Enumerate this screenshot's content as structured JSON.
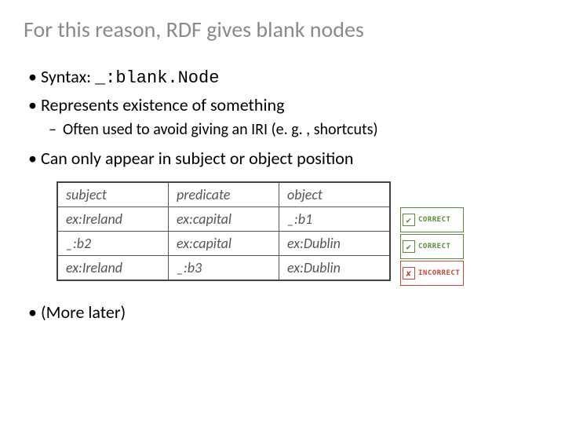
{
  "title": "For this reason, RDF gives blank nodes",
  "bullets": {
    "syntax_label": "Syntax: ",
    "syntax_code": "_:blank.Node",
    "represents": "Represents existence of something",
    "represents_sub": "Often used to avoid giving an IRI (e. g. , shortcuts)",
    "position": "Can only appear in subject or object position",
    "more": "(More later)"
  },
  "table": {
    "headers": {
      "s": "subject",
      "p": "predicate",
      "o": "object"
    },
    "rows": [
      {
        "s": "ex:Ireland",
        "p": "ex:capital",
        "o": "_:b1",
        "status": "correct"
      },
      {
        "s": "_:b2",
        "p": "ex:capital",
        "o": "ex:Dublin",
        "status": "correct"
      },
      {
        "s": "ex:Ireland",
        "p": "_:b3",
        "o": "ex:Dublin",
        "status": "incorrect"
      }
    ]
  },
  "badges": {
    "correct": {
      "mark": "✔",
      "label": "CORRECT"
    },
    "incorrect": {
      "mark": "✘",
      "label": "INCORRECT"
    }
  }
}
